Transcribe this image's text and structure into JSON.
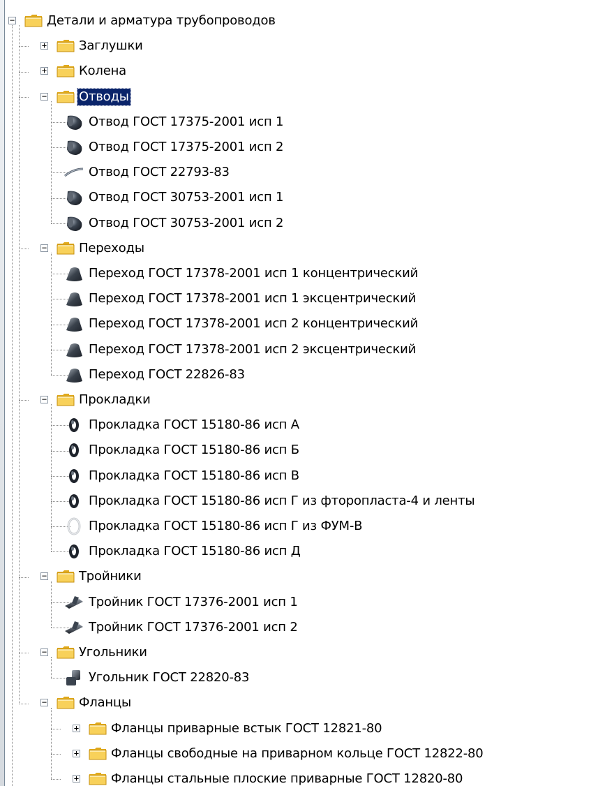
{
  "tree": [
    {
      "label": "Детали и арматура трубопроводов",
      "level": 0,
      "kind": "folder",
      "state": "expanded"
    },
    {
      "label": "Заглушки",
      "level": 1,
      "kind": "folder",
      "state": "collapsed"
    },
    {
      "label": "Колена",
      "level": 1,
      "kind": "folder",
      "state": "collapsed"
    },
    {
      "label": "Отводы",
      "level": 1,
      "kind": "folder",
      "state": "expanded",
      "selected": true
    },
    {
      "label": "Отвод ГОСТ 17375-2001 исп 1",
      "level": 2,
      "kind": "item",
      "icon": "elbow-icon"
    },
    {
      "label": "Отвод ГОСТ 17375-2001 исп 2",
      "level": 2,
      "kind": "item",
      "icon": "elbow-icon"
    },
    {
      "label": "Отвод ГОСТ 22793-83",
      "level": 2,
      "kind": "item",
      "icon": "bent-pipe-icon"
    },
    {
      "label": "Отвод ГОСТ 30753-2001 исп 1",
      "level": 2,
      "kind": "item",
      "icon": "elbow-icon"
    },
    {
      "label": "Отвод ГОСТ 30753-2001 исп 2",
      "level": 2,
      "kind": "item",
      "icon": "elbow-icon"
    },
    {
      "label": "Переходы",
      "level": 1,
      "kind": "folder",
      "state": "expanded"
    },
    {
      "label": "Переход ГОСТ 17378-2001 исп 1 концентрический",
      "level": 2,
      "kind": "item",
      "icon": "reducer-icon"
    },
    {
      "label": "Переход ГОСТ 17378-2001 исп 1 эксцентрический",
      "level": 2,
      "kind": "item",
      "icon": "reducer-icon"
    },
    {
      "label": "Переход ГОСТ 17378-2001 исп 2 концентрический",
      "level": 2,
      "kind": "item",
      "icon": "reducer-icon"
    },
    {
      "label": "Переход ГОСТ 17378-2001 исп 2 эксцентрический",
      "level": 2,
      "kind": "item",
      "icon": "reducer-icon"
    },
    {
      "label": "Переход ГОСТ 22826-83",
      "level": 2,
      "kind": "item",
      "icon": "reducer-icon"
    },
    {
      "label": "Прокладки",
      "level": 1,
      "kind": "folder",
      "state": "expanded"
    },
    {
      "label": "Прокладка ГОСТ 15180-86 исп А",
      "level": 2,
      "kind": "item",
      "icon": "gasket-icon"
    },
    {
      "label": "Прокладка ГОСТ 15180-86 исп Б",
      "level": 2,
      "kind": "item",
      "icon": "gasket-icon"
    },
    {
      "label": "Прокладка ГОСТ 15180-86 исп В",
      "level": 2,
      "kind": "item",
      "icon": "gasket-icon"
    },
    {
      "label": "Прокладка ГОСТ 15180-86 исп Г из фторопласта-4 и ленты",
      "level": 2,
      "kind": "item",
      "icon": "gasket-icon"
    },
    {
      "label": "Прокладка ГОСТ 15180-86 исп Г из ФУМ-В",
      "level": 2,
      "kind": "item",
      "icon": "gasket-light-icon"
    },
    {
      "label": "Прокладка ГОСТ 15180-86 исп Д",
      "level": 2,
      "kind": "item",
      "icon": "gasket-icon"
    },
    {
      "label": "Тройники",
      "level": 1,
      "kind": "folder",
      "state": "expanded"
    },
    {
      "label": "Тройник ГОСТ 17376-2001 исп 1",
      "level": 2,
      "kind": "item",
      "icon": "tee-icon"
    },
    {
      "label": "Тройник ГОСТ 17376-2001 исп 2",
      "level": 2,
      "kind": "item",
      "icon": "tee-icon"
    },
    {
      "label": "Угольники",
      "level": 1,
      "kind": "folder",
      "state": "expanded"
    },
    {
      "label": "Угольник ГОСТ 22820-83",
      "level": 2,
      "kind": "item",
      "icon": "angle-fitting-icon"
    },
    {
      "label": "Фланцы",
      "level": 1,
      "kind": "folder",
      "state": "expanded"
    },
    {
      "label": "Фланцы приварные встык ГОСТ 12821-80",
      "level": 2,
      "kind": "folder",
      "state": "collapsed"
    },
    {
      "label": "Фланцы свободные на приварном кольце ГОСТ 12822-80",
      "level": 2,
      "kind": "folder",
      "state": "collapsed"
    },
    {
      "label": "Фланцы стальные плоские приварные ГОСТ 12820-80",
      "level": 2,
      "kind": "folder",
      "state": "collapsed"
    }
  ],
  "colors": {
    "selection": "#0a246a",
    "folder": "#f5c842",
    "icon_dark": "#1e232b"
  }
}
